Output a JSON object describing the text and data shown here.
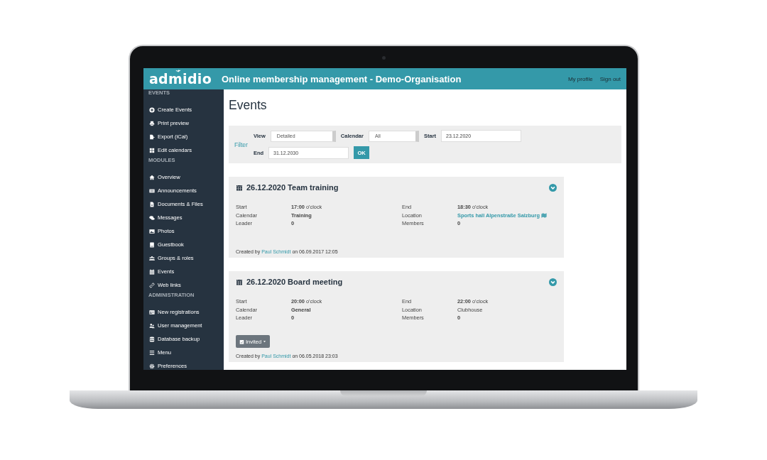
{
  "header": {
    "logo": "admidio",
    "title": "Online membership management - Demo-Organisation",
    "links": [
      "My profile",
      "Sign out"
    ]
  },
  "sidebar": {
    "sections": [
      {
        "heading": "EVENTS",
        "items": [
          "Create Events",
          "Print preview",
          "Export (iCal)",
          "Edit calendars"
        ]
      },
      {
        "heading": "MODULES",
        "items": [
          "Overview",
          "Announcements",
          "Documents & Files",
          "Messages",
          "Photos",
          "Guestbook",
          "Groups & roles",
          "Events",
          "Web links"
        ]
      },
      {
        "heading": "ADMINISTRATION",
        "items": [
          "New registrations",
          "User management",
          "Database backup",
          "Menu",
          "Preferences"
        ]
      }
    ]
  },
  "page_title": "Events",
  "filter": {
    "label": "Filter",
    "view": {
      "label": "View",
      "value": "Detailed"
    },
    "calendar": {
      "label": "Calendar",
      "value": "All"
    },
    "start": {
      "label": "Start",
      "value": "23.12.2020"
    },
    "end": {
      "label": "End",
      "value": "31.12.2030"
    },
    "button": "OK"
  },
  "events": [
    {
      "title": "26.12.2020 Team training",
      "left": [
        {
          "label": "Start",
          "value": "**17:00** o'clock",
          "kind": "text"
        },
        {
          "label": "Calendar",
          "value": "Training",
          "kind": "strong"
        },
        {
          "label": "Leader",
          "value": "0",
          "kind": "strong"
        }
      ],
      "right": [
        {
          "label": "End",
          "value": "**18:30** o'clock",
          "kind": "text"
        },
        {
          "label": "Location",
          "value": "Sports hall Alpenstraße Salzburg",
          "kind": "link"
        },
        {
          "label": "Members",
          "value": "0",
          "kind": "strong"
        }
      ],
      "created": {
        "prefix": "Created by",
        "author": "Paul Schmidt",
        "suffix": "on 06.09.2017 12:05"
      }
    },
    {
      "title": "26.12.2020 Board meeting",
      "left": [
        {
          "label": "Start",
          "value": "**20:00** o'clock",
          "kind": "text"
        },
        {
          "label": "Calendar",
          "value": "General",
          "kind": "strong"
        },
        {
          "label": "Leader",
          "value": "0",
          "kind": "strong"
        }
      ],
      "right": [
        {
          "label": "End",
          "value": "**22:00** o'clock",
          "kind": "text"
        },
        {
          "label": "Location",
          "value": "Clubhouse",
          "kind": "text"
        },
        {
          "label": "Members",
          "value": "0",
          "kind": "strong"
        }
      ],
      "participation": "Invited",
      "created": {
        "prefix": "Created by",
        "author": "Paul Schmidt",
        "suffix": "on 06.05.2018 23:03"
      }
    }
  ]
}
